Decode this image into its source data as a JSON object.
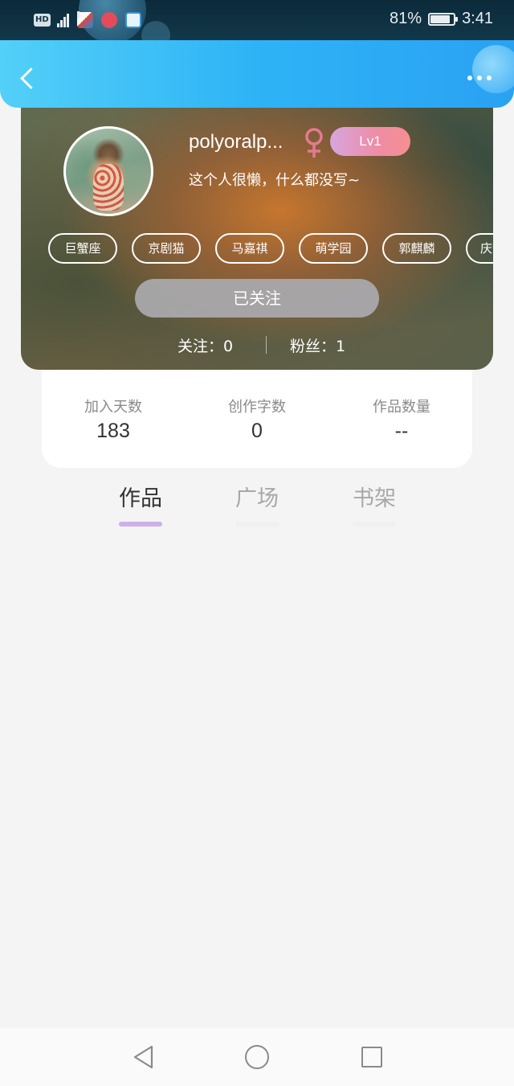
{
  "status_bar": {
    "network_badge": "HD",
    "network_type": "4G",
    "signal_bars": 4,
    "battery_percent": "81%",
    "battery_level": 0.81,
    "time": "3:41",
    "notification_icons": [
      "tv-app-icon",
      "social-app-icon",
      "browser-app-icon"
    ]
  },
  "header": {
    "back_icon": "chevron-left-icon",
    "more_icon": "more-dots-icon"
  },
  "profile": {
    "username": "polyoralp...",
    "gender_icon": "female-symbol-icon",
    "level": "Lv1",
    "bio": "这个人很懒，什么都没写~",
    "tags": [
      "巨蟹座",
      "京剧猫",
      "马嘉祺",
      "萌学园",
      "郭麒麟",
      "庆余"
    ],
    "follow_button": "已关注",
    "following": "关注：0",
    "fans": "粉丝：1"
  },
  "stats": [
    {
      "label": "加入天数",
      "value": "183"
    },
    {
      "label": "创作字数",
      "value": "0"
    },
    {
      "label": "作品数量",
      "value": "--"
    }
  ],
  "tabs": [
    {
      "label": "作品",
      "active": true
    },
    {
      "label": "广场",
      "active": false
    },
    {
      "label": "书架",
      "active": false
    }
  ],
  "colors": {
    "header_gradient_start": "#53d0f8",
    "header_gradient_end": "#2aa2f2",
    "level_badge": "#ef8ca5",
    "gender_icon": "#e57a92",
    "active_tab_underline": "#cdb0ec",
    "page_background": "#f4f4f4"
  },
  "nav_bar": {
    "back_icon": "triangle-back-icon",
    "home_icon": "circle-home-icon",
    "recent_icon": "square-recents-icon"
  }
}
